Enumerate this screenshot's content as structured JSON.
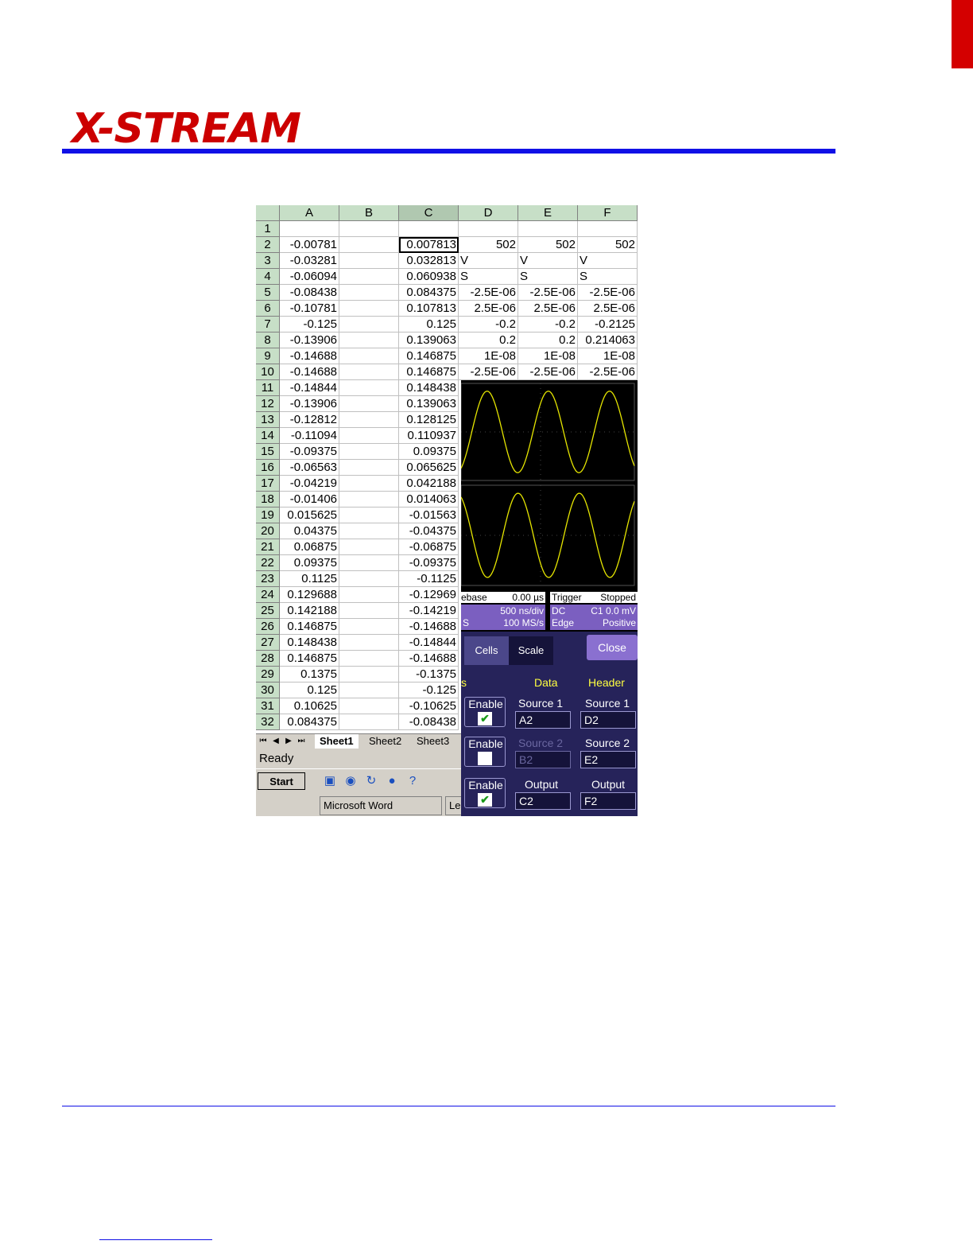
{
  "logo_text": "X-STREAM",
  "spreadsheet": {
    "columns": [
      "A",
      "B",
      "C",
      "D",
      "E",
      "F"
    ],
    "rows": [
      {
        "n": "1",
        "A": "",
        "B": "",
        "C": "",
        "D": "",
        "E": "",
        "F": ""
      },
      {
        "n": "2",
        "A": "-0.00781",
        "B": "",
        "C": "0.007813",
        "D": "502",
        "E": "502",
        "F": "502"
      },
      {
        "n": "3",
        "A": "-0.03281",
        "B": "",
        "C": "0.032813",
        "D": "V",
        "E": "V",
        "F": "V"
      },
      {
        "n": "4",
        "A": "-0.06094",
        "B": "",
        "C": "0.060938",
        "D": "S",
        "E": "S",
        "F": "S"
      },
      {
        "n": "5",
        "A": "-0.08438",
        "B": "",
        "C": "0.084375",
        "D": "-2.5E-06",
        "E": "-2.5E-06",
        "F": "-2.5E-06"
      },
      {
        "n": "6",
        "A": "-0.10781",
        "B": "",
        "C": "0.107813",
        "D": "2.5E-06",
        "E": "2.5E-06",
        "F": "2.5E-06"
      },
      {
        "n": "7",
        "A": "-0.125",
        "B": "",
        "C": "0.125",
        "D": "-0.2",
        "E": "-0.2",
        "F": "-0.2125"
      },
      {
        "n": "8",
        "A": "-0.13906",
        "B": "",
        "C": "0.139063",
        "D": "0.2",
        "E": "0.2",
        "F": "0.214063"
      },
      {
        "n": "9",
        "A": "-0.14688",
        "B": "",
        "C": "0.146875",
        "D": "1E-08",
        "E": "1E-08",
        "F": "1E-08"
      },
      {
        "n": "10",
        "A": "-0.14688",
        "B": "",
        "C": "0.146875",
        "D": "-2.5E-06",
        "E": "-2.5E-06",
        "F": "-2.5E-06"
      },
      {
        "n": "11",
        "A": "-0.14844",
        "B": "",
        "C": "0.148438"
      },
      {
        "n": "12",
        "A": "-0.13906",
        "B": "",
        "C": "0.139063"
      },
      {
        "n": "13",
        "A": "-0.12812",
        "B": "",
        "C": "0.128125"
      },
      {
        "n": "14",
        "A": "-0.11094",
        "B": "",
        "C": "0.110937"
      },
      {
        "n": "15",
        "A": "-0.09375",
        "B": "",
        "C": "0.09375"
      },
      {
        "n": "16",
        "A": "-0.06563",
        "B": "",
        "C": "0.065625"
      },
      {
        "n": "17",
        "A": "-0.04219",
        "B": "",
        "C": "0.042188"
      },
      {
        "n": "18",
        "A": "-0.01406",
        "B": "",
        "C": "0.014063"
      },
      {
        "n": "19",
        "A": "0.015625",
        "B": "",
        "C": "-0.01563"
      },
      {
        "n": "20",
        "A": "0.04375",
        "B": "",
        "C": "-0.04375"
      },
      {
        "n": "21",
        "A": "0.06875",
        "B": "",
        "C": "-0.06875"
      },
      {
        "n": "22",
        "A": "0.09375",
        "B": "",
        "C": "-0.09375"
      },
      {
        "n": "23",
        "A": "0.1125",
        "B": "",
        "C": "-0.1125"
      },
      {
        "n": "24",
        "A": "0.129688",
        "B": "",
        "C": "-0.12969"
      },
      {
        "n": "25",
        "A": "0.142188",
        "B": "",
        "C": "-0.14219"
      },
      {
        "n": "26",
        "A": "0.146875",
        "B": "",
        "C": "-0.14688"
      },
      {
        "n": "27",
        "A": "0.148438",
        "B": "",
        "C": "-0.14844"
      },
      {
        "n": "28",
        "A": "0.146875",
        "B": "",
        "C": "-0.14688"
      },
      {
        "n": "29",
        "A": "0.1375",
        "B": "",
        "C": "-0.1375"
      },
      {
        "n": "30",
        "A": "0.125",
        "B": "",
        "C": "-0.125"
      },
      {
        "n": "31",
        "A": "0.10625",
        "B": "",
        "C": "-0.10625"
      },
      {
        "n": "32",
        "A": "0.084375",
        "B": "",
        "C": "-0.08438"
      }
    ],
    "sheet_tabs": [
      "Sheet1",
      "Sheet2",
      "Sheet3"
    ],
    "status": "Ready"
  },
  "taskbar": {
    "start": "Start",
    "items": [
      "Microsoft Word",
      "LeC"
    ]
  },
  "scope": {
    "timebase_label": "ebase",
    "timebase_value": "0.00 µs",
    "timebase_div": "500 ns/div",
    "sample_label": "S",
    "sample_rate": "100 MS/s",
    "trigger_label": "Trigger",
    "trigger_state": "Stopped",
    "trigger_coupling": "DC",
    "trigger_level": "C1  0.0 mV",
    "trigger_type": "Edge",
    "trigger_slope": "Positive",
    "trace_color": "#e6e600"
  },
  "panel": {
    "tabs": [
      "Cells",
      "Scale"
    ],
    "close": "Close",
    "cut_label": "s",
    "col_data": "Data",
    "col_header": "Header",
    "enable": "Enable",
    "source1": "Source 1",
    "source2": "Source 2",
    "output": "Output",
    "fields": {
      "data_src1": "A2",
      "hdr_src1": "D2",
      "data_src2": "B2",
      "hdr_src2": "E2",
      "data_out": "C2",
      "hdr_out": "F2"
    },
    "check_mark": "✔"
  }
}
